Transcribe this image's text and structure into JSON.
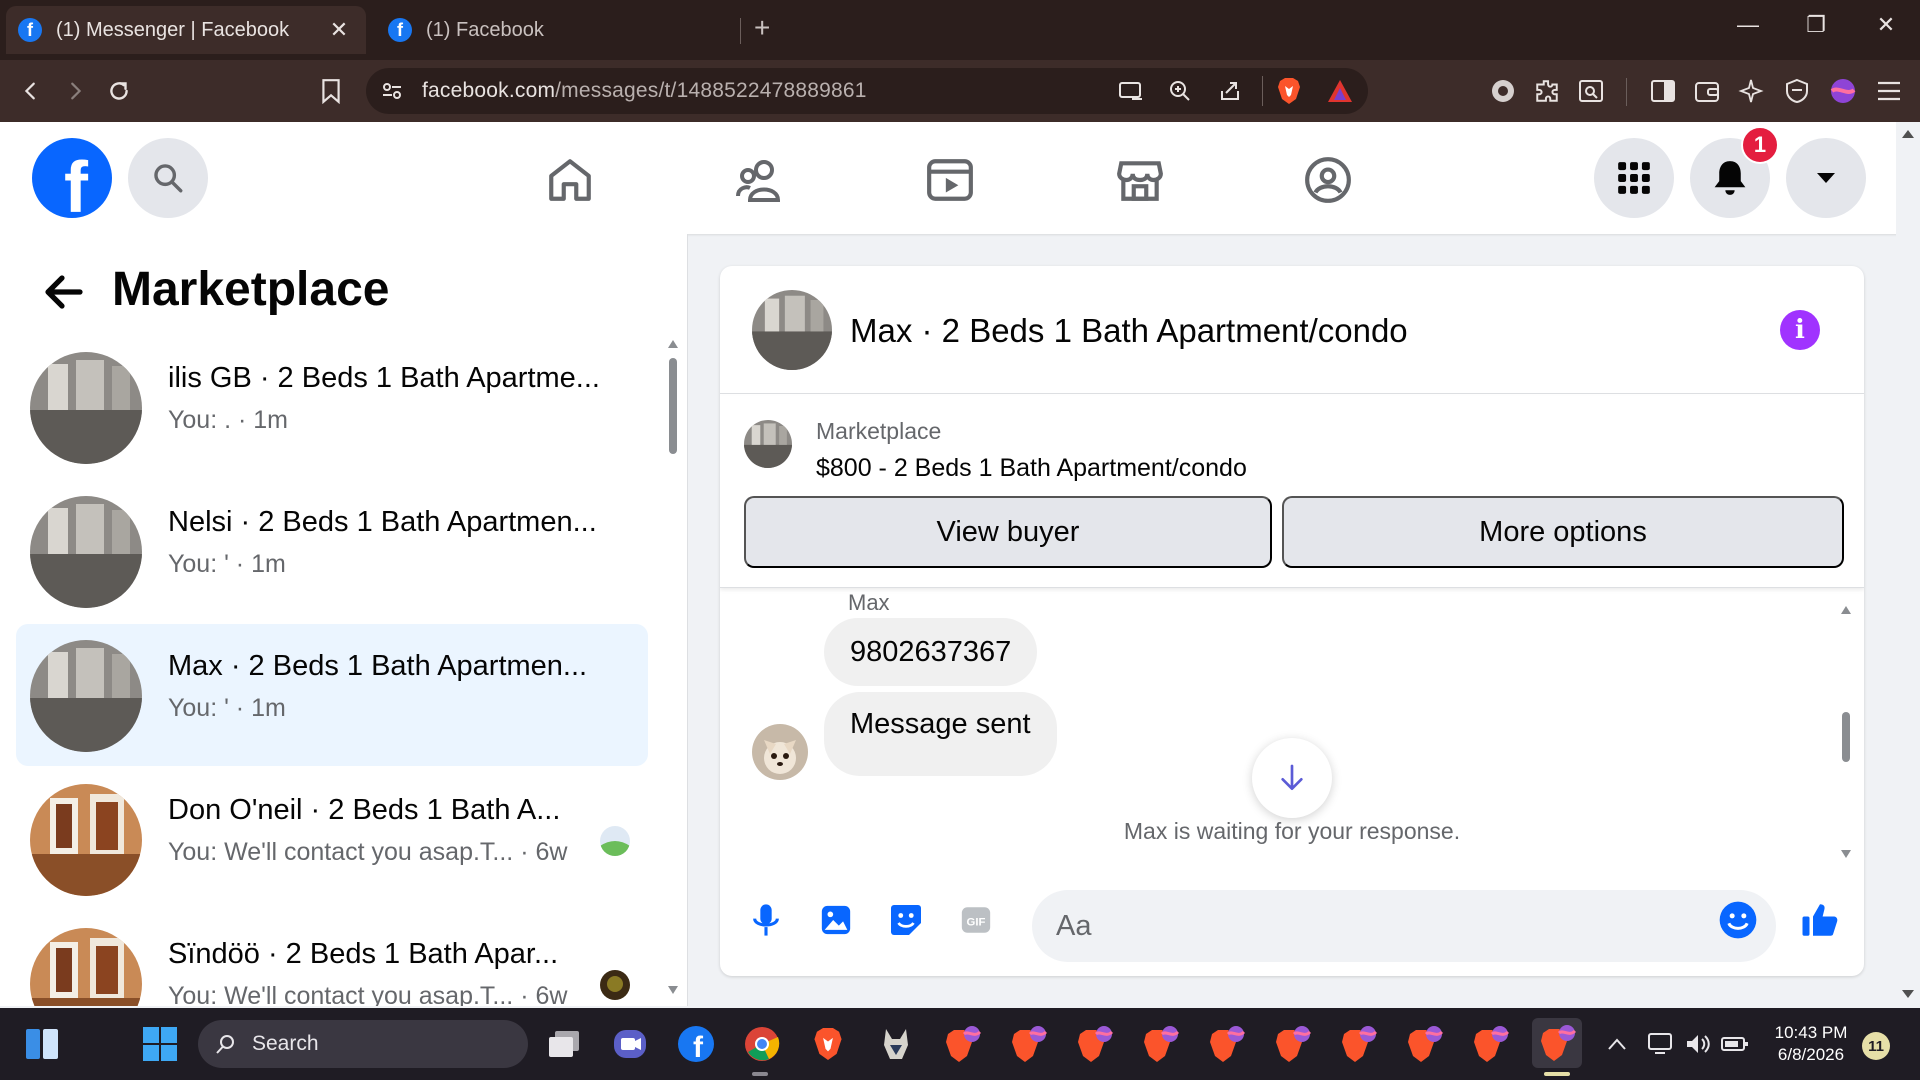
{
  "browser": {
    "tabs": [
      {
        "title": "(1) Messenger | Facebook",
        "active": true
      },
      {
        "title": "(1) Facebook",
        "active": false
      }
    ],
    "url": {
      "host": "facebook.com",
      "path": "/messages/t/1488522478889861"
    }
  },
  "fb": {
    "logo_letter": "f",
    "notification_count": "1"
  },
  "sidebar": {
    "title": "Marketplace",
    "conversations": [
      {
        "name": "ilis GB · 2 Beds 1 Bath Apartme...",
        "snippet": "You: . · 1m",
        "photo": "room-gray"
      },
      {
        "name": "Nelsi · 2 Beds 1 Bath Apartmen...",
        "snippet": "You: ' · 1m",
        "photo": "room-gray"
      },
      {
        "name": "Max · 2 Beds 1 Bath Apartmen...",
        "snippet": "You: ' · 1m",
        "photo": "room-gray",
        "selected": true
      },
      {
        "name": "Don O'neil · 2 Beds 1 Bath A...",
        "snippet": "You: We'll contact you asap.T...",
        "time": "· 6w",
        "photo": "room-wood"
      },
      {
        "name": "Sïndöö · 2 Beds 1 Bath Apar...",
        "snippet": "You: We'll contact you asap.T...",
        "time": "· 6w",
        "photo": "room-wood"
      }
    ]
  },
  "chat": {
    "title": "Max · 2 Beds 1 Bath Apartment/condo",
    "info_glyph": "i",
    "listing": {
      "source": "Marketplace",
      "title": "$800 - 2 Beds 1 Bath Apartment/condo",
      "view_buyer_label": "View buyer",
      "more_options_label": "More options"
    },
    "sender": "Max",
    "messages": [
      {
        "text": "9802637367"
      },
      {
        "text": "Message sent"
      }
    ],
    "waiting_text": "Max is waiting for your response.",
    "composer_placeholder": "Aa"
  },
  "taskbar": {
    "search_label": "Search",
    "time": "10:43 PM",
    "date": "6/8/2026",
    "notification_count": "11"
  },
  "colors": {
    "fb_blue": "#0866ff",
    "selected_row": "#ebf5ff",
    "badge_red": "#e41e3f",
    "info_purple": "#a033ff"
  }
}
